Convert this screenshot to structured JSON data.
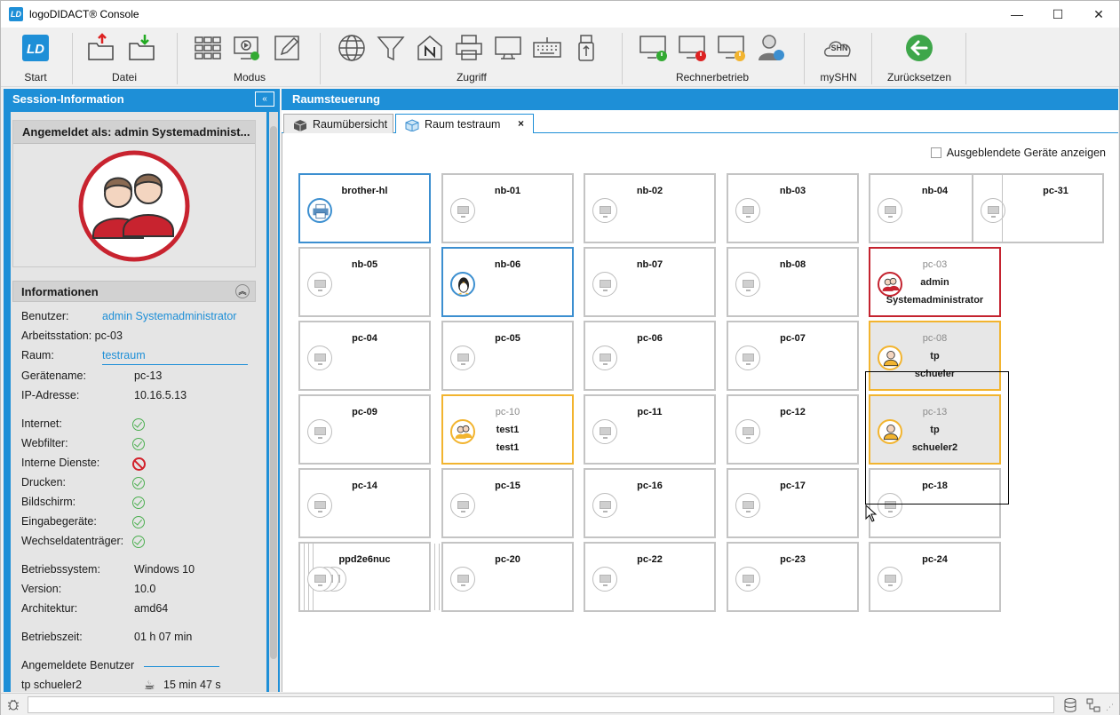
{
  "window": {
    "app_icon_text": "LD",
    "title": "logoDIDACT® Console",
    "minimize_symbol": "—",
    "maximize_symbol": "☐",
    "close_symbol": "✕"
  },
  "ribbon": {
    "groups": {
      "start": "Start",
      "datei": "Datei",
      "modus": "Modus",
      "zugriff": "Zugriff",
      "rechnerbetrieb": "Rechnerbetrieb",
      "myshn": "mySHN",
      "zuruecksetzen": "Zurücksetzen"
    },
    "accent": "#1e8fd7"
  },
  "session": {
    "header": "Session-Information",
    "collapse_symbol": "«",
    "logged_in_as": "Angemeldet als: admin Systemadminist...",
    "info_header": "Informationen",
    "rows": {
      "benutzer_label": "Benutzer:",
      "benutzer_value": "admin Systemadministrator",
      "arbeitsstation": "Arbeitsstation: pc-03",
      "raum_label": "Raum:",
      "raum_value": "testraum",
      "geraetename_label": "Gerätename:",
      "geraetename_value": "pc-13",
      "ip_label": "IP-Adresse:",
      "ip_value": "10.16.5.13",
      "internet": "Internet:",
      "webfilter": "Webfilter:",
      "interne_dienste": "Interne Dienste:",
      "drucken": "Drucken:",
      "bildschirm": "Bildschirm:",
      "eingabegeraete": "Eingabegeräte:",
      "wechseldatentraeger": "Wechseldatenträger:",
      "os_label": "Betriebssystem:",
      "os_value": "Windows 10",
      "version_label": "Version:",
      "version_value": "10.0",
      "arch_label": "Architektur:",
      "arch_value": "amd64",
      "uptime_label": "Betriebszeit:",
      "uptime_value": "01 h 07 min",
      "logged_users_label": "Angemeldete Benutzer",
      "logged_user": "tp schueler2",
      "logged_user_time": "15 min 47 s"
    },
    "status_ok_color": "#4caf50",
    "status_blocked_color": "#d2202a"
  },
  "room": {
    "header": "Raumsteuerung",
    "tabs": [
      "Raumübersicht",
      "Raum testraum"
    ],
    "tab_close": "×",
    "show_hidden_label": "Ausgeblendete Geräte anzeigen",
    "devices": {
      "brother_hl": "brother-hl",
      "nb01": "nb-01",
      "nb02": "nb-02",
      "nb03": "nb-03",
      "nb04": "nb-04",
      "pc31": "pc-31",
      "nb05": "nb-05",
      "nb06": "nb-06",
      "nb07": "nb-07",
      "nb08": "nb-08",
      "pc03": "pc-03",
      "pc03_line2": "admin",
      "pc03_line3": "Systemadministrator",
      "pc04": "pc-04",
      "pc05": "pc-05",
      "pc06": "pc-06",
      "pc07": "pc-07",
      "pc08": "pc-08",
      "pc08_line2": "tp",
      "pc08_line3": "schueler",
      "pc09": "pc-09",
      "pc10": "pc-10",
      "pc10_line2": "test1",
      "pc10_line3": "test1",
      "pc11": "pc-11",
      "pc12": "pc-12",
      "pc13": "pc-13",
      "pc13_line2": "tp",
      "pc13_line3": "schueler2",
      "pc14": "pc-14",
      "pc15": "pc-15",
      "pc16": "pc-16",
      "pc17": "pc-17",
      "pc18": "pc-18",
      "stacked": "ppd2e6nuc",
      "pc20": "pc-20",
      "pc22": "pc-22",
      "pc23": "pc-23",
      "pc24": "pc-24"
    }
  }
}
